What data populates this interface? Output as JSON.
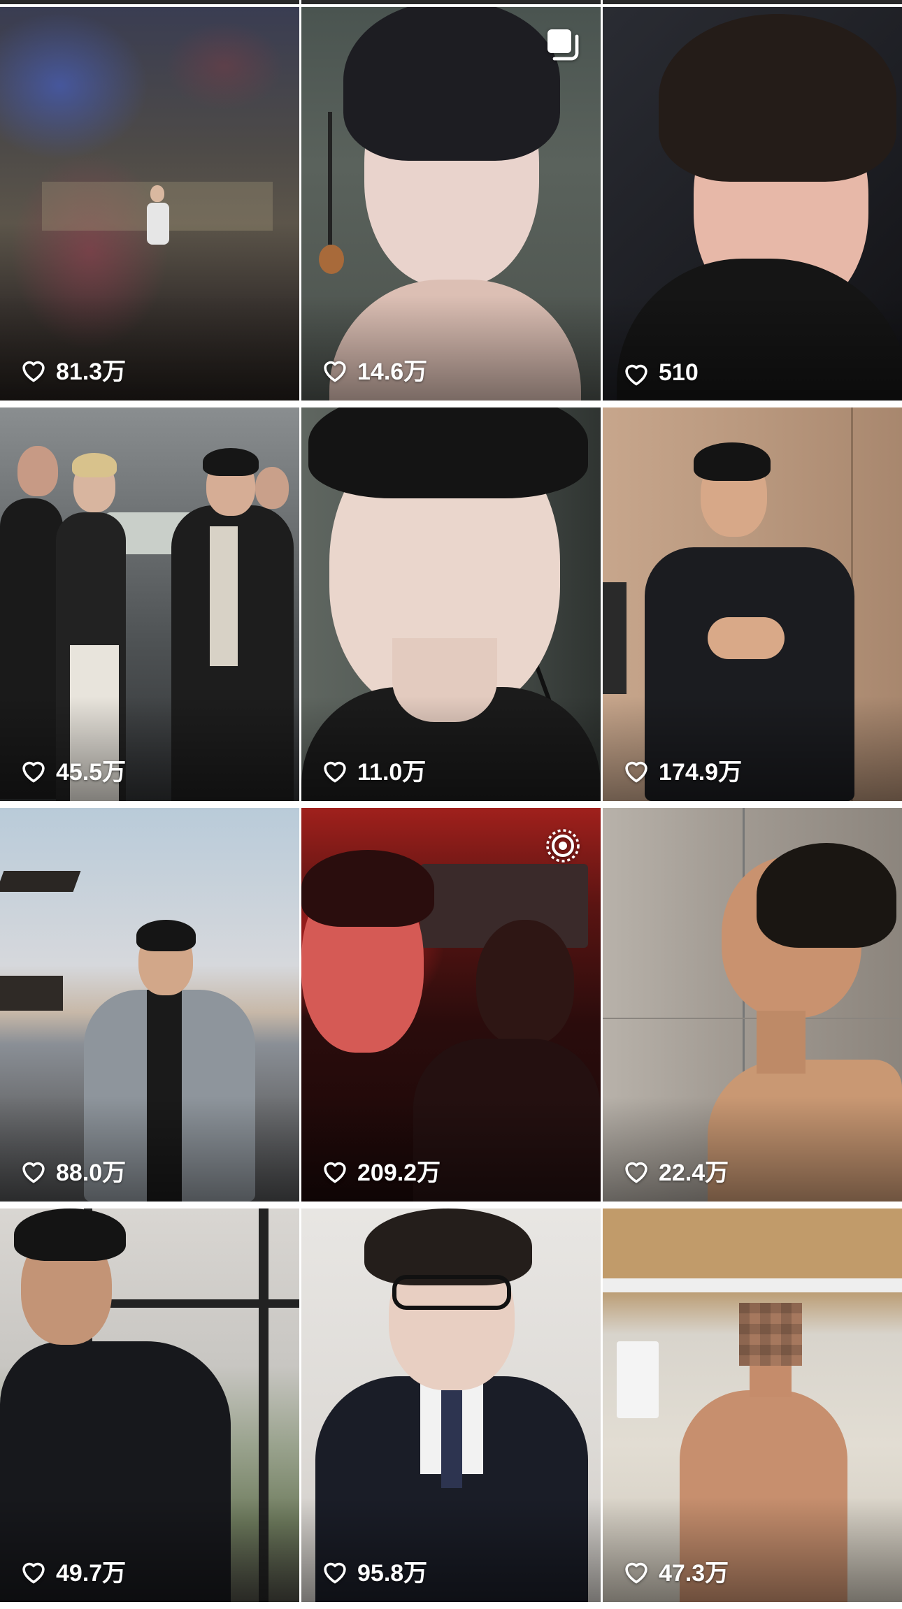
{
  "grid": {
    "tiles": [
      {
        "likes": "81.3万",
        "badge": ""
      },
      {
        "likes": "14.6万",
        "badge": "multi-photo-icon"
      },
      {
        "likes": "510",
        "badge": ""
      },
      {
        "likes": "45.5万",
        "badge": ""
      },
      {
        "likes": "11.0万",
        "badge": ""
      },
      {
        "likes": "174.9万",
        "badge": ""
      },
      {
        "likes": "88.0万",
        "badge": ""
      },
      {
        "likes": "209.2万",
        "badge": "live-photo-icon"
      },
      {
        "likes": "22.4万",
        "badge": ""
      },
      {
        "likes": "49.7万",
        "badge": ""
      },
      {
        "likes": "95.8万",
        "badge": ""
      },
      {
        "likes": "47.3万",
        "badge": ""
      }
    ]
  },
  "icons": {
    "like": "heart-outline-icon",
    "multi_photo": "multi-photo-icon",
    "live_photo": "live-photo-icon"
  }
}
